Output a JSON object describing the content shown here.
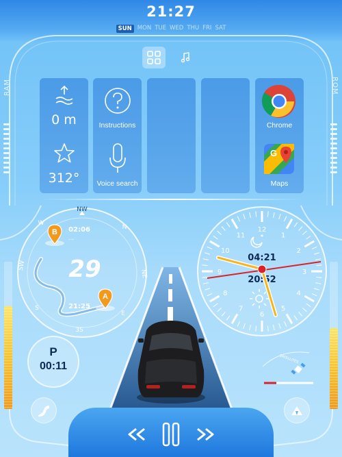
{
  "header": {
    "time": "21:27",
    "days": [
      {
        "label": "SUN",
        "active": true
      },
      {
        "label": "MON",
        "active": false
      },
      {
        "label": "TUE",
        "active": false
      },
      {
        "label": "WED",
        "active": false
      },
      {
        "label": "THU",
        "active": false
      },
      {
        "label": "FRI",
        "active": false
      },
      {
        "label": "SAT",
        "active": false
      }
    ]
  },
  "side": {
    "left_label": "RAM",
    "right_label": "ROM",
    "left_level": 0.7,
    "right_level": 0.55
  },
  "tabs": [
    {
      "name": "apps",
      "icon": "grid-icon",
      "active": true
    },
    {
      "name": "music",
      "icon": "music-note-icon",
      "active": false
    }
  ],
  "tiles": {
    "altitude": "0 m",
    "heading": "312°",
    "instructions_label": "Instructions",
    "voice_search_label": "Voice search",
    "chrome_label": "Chrome",
    "maps_label": "Maps"
  },
  "compass": {
    "speed": "29",
    "dirs": {
      "nw": "NW",
      "w": "W",
      "sw": "SW",
      "s": "S",
      "ss": "3S",
      "e": "E",
      "ne": "NE",
      "n": "N"
    },
    "marker_b": {
      "letter": "B",
      "time": "02:06",
      "sub": "..."
    },
    "marker_a": {
      "letter": "A",
      "time": "21:25"
    }
  },
  "clock": {
    "hour_labels": [
      "12",
      "1",
      "2",
      "3",
      "4",
      "5",
      "6",
      "7",
      "8",
      "9",
      "10",
      "11"
    ],
    "moon_time": "04:21",
    "sun_time": "20:52",
    "satellite_label": "SATELLITES"
  },
  "parking": {
    "letter": "P",
    "time": "00:11"
  },
  "media": {
    "prev": "prev-icon",
    "pause": "pause-icon",
    "next": "next-icon"
  },
  "colors": {
    "accent": "#2f88e6",
    "orange": "#f29a1d",
    "red": "#d8232a"
  }
}
